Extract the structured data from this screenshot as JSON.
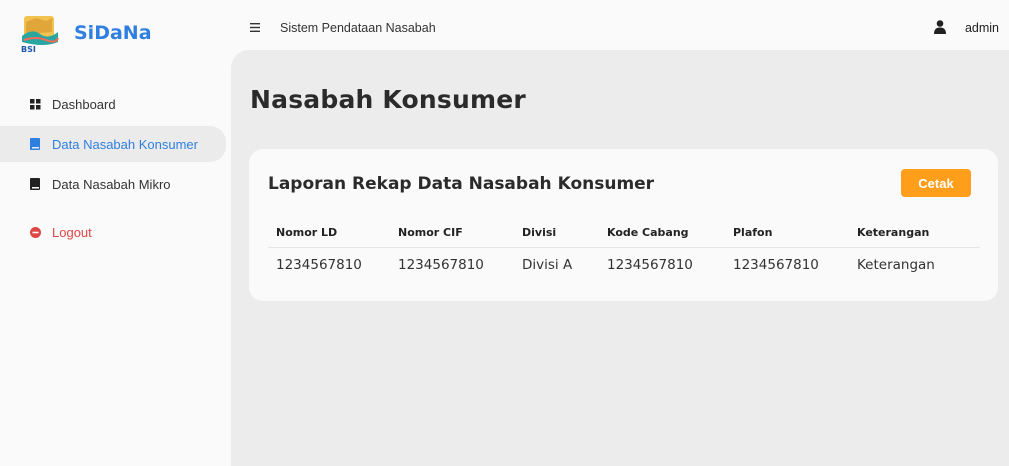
{
  "brand": {
    "name": "SiDaNa",
    "logo_text": "BSI"
  },
  "sidebar": {
    "items": [
      {
        "label": "Dashboard",
        "icon": "grid-icon",
        "active": false
      },
      {
        "label": "Data Nasabah Konsumer",
        "icon": "book-icon",
        "active": true
      },
      {
        "label": "Data Nasabah Mikro",
        "icon": "book-icon",
        "active": false
      },
      {
        "label": "Logout",
        "icon": "power-icon",
        "active": false
      }
    ]
  },
  "topbar": {
    "title": "Sistem Pendataan Nasabah",
    "user": "admin"
  },
  "main": {
    "page_title": "Nasabah Konsumer",
    "card_title": "Laporan Rekap Data Nasabah Konsumer",
    "print_label": "Cetak",
    "table": {
      "headers": [
        "Nomor LD",
        "Nomor CIF",
        "Divisi",
        "Kode Cabang",
        "Plafon",
        "Keterangan"
      ],
      "rows": [
        [
          "1234567810",
          "1234567810",
          "Divisi A",
          "1234567810",
          "1234567810",
          "Keterangan"
        ]
      ]
    }
  },
  "colors": {
    "accent": "#2f7fe0",
    "button": "#ff9e1b",
    "logout": "#e04545"
  }
}
